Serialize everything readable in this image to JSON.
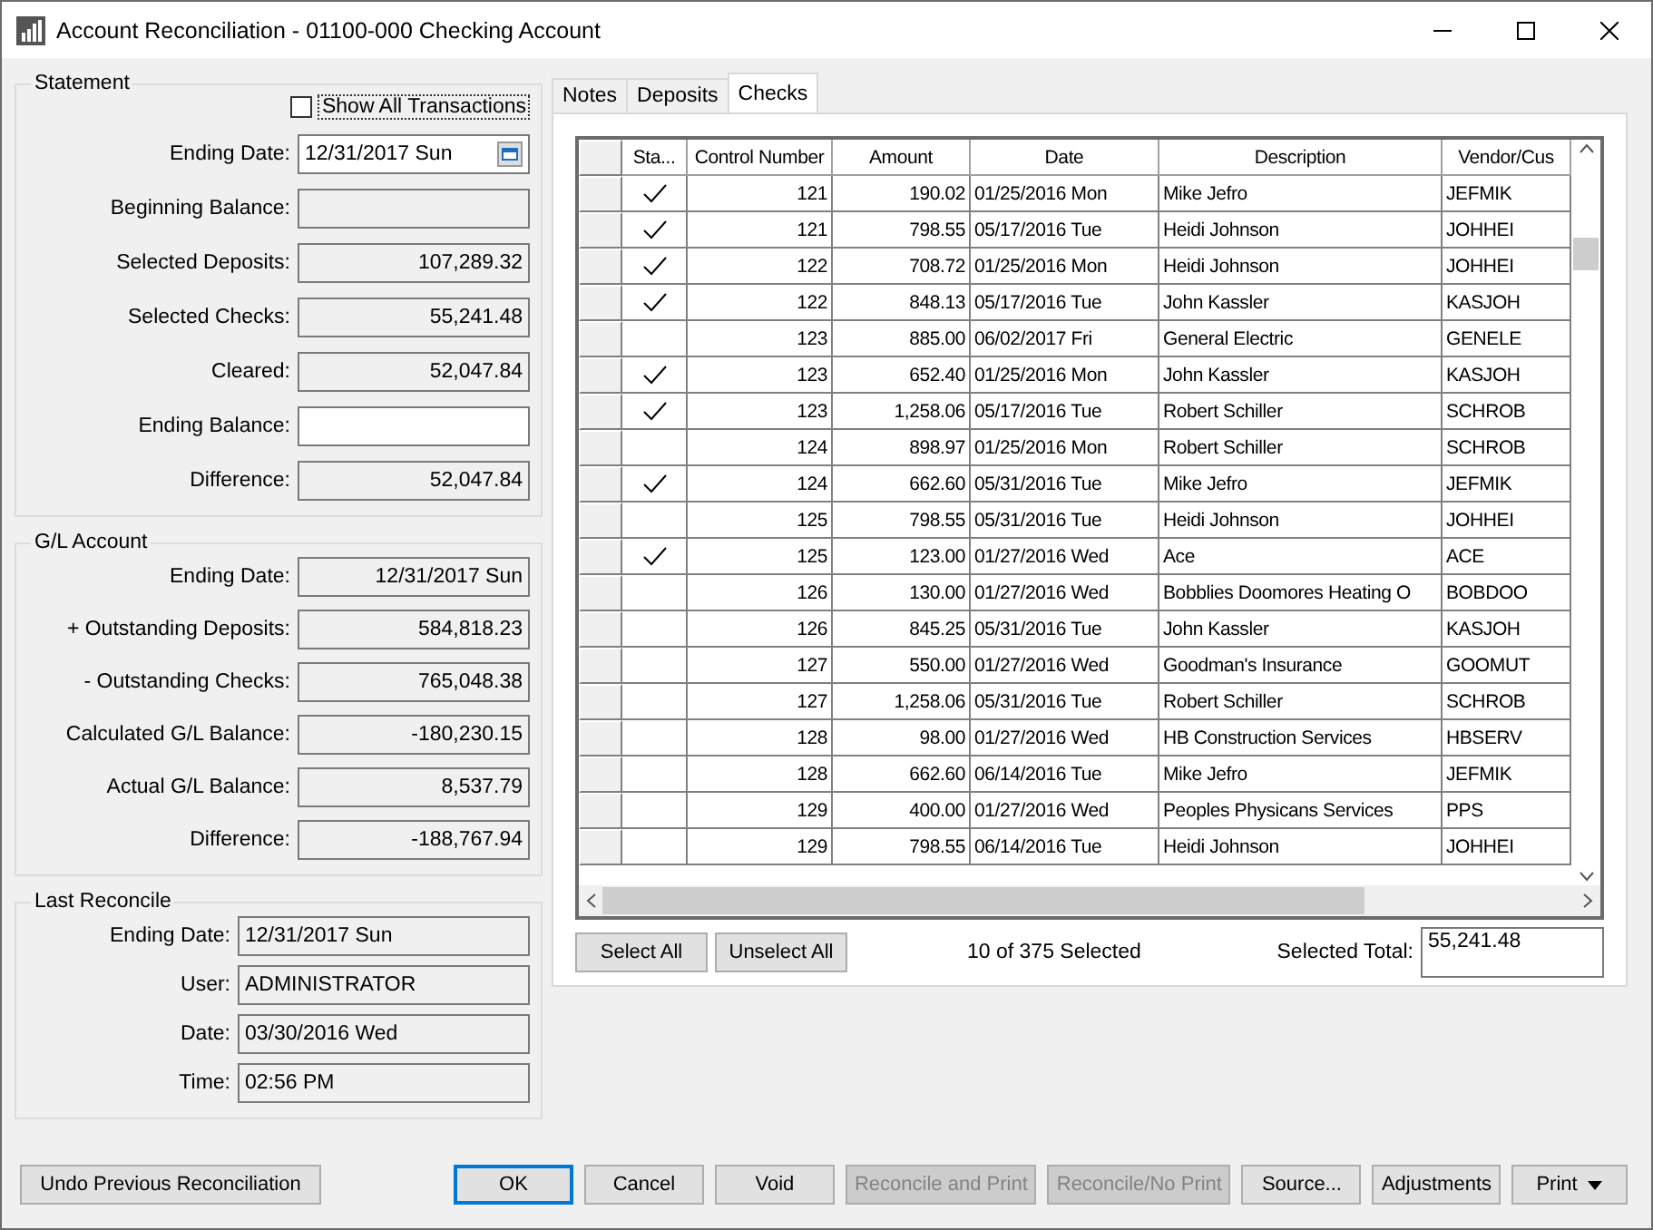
{
  "window": {
    "title": "Account Reconciliation - 01100-000 Checking Account"
  },
  "statement": {
    "title": "Statement",
    "show_all": {
      "label": "Show All Transactions",
      "checked": false
    },
    "fields": [
      {
        "label": "Ending Date:",
        "value": "12/31/2017 Sun",
        "kind": "date"
      },
      {
        "label": "Beginning Balance:",
        "kind": "readonly"
      },
      {
        "label": "Selected Deposits:",
        "value": "107,289.32",
        "kind": "readonly"
      },
      {
        "label": "Selected Checks:",
        "value": "55,241.48",
        "kind": "readonly"
      },
      {
        "label": "Cleared:",
        "value": "52,047.84",
        "kind": "readonly"
      },
      {
        "label": "Ending Balance:",
        "kind": "editable"
      },
      {
        "label": "Difference:",
        "value": "52,047.84",
        "kind": "readonly"
      }
    ]
  },
  "gl_account": {
    "title": "G/L Account",
    "fields": [
      {
        "label": "Ending Date:",
        "value": "12/31/2017 Sun"
      },
      {
        "label": "+ Outstanding Deposits:",
        "value": "584,818.23"
      },
      {
        "label": "- Outstanding Checks:",
        "value": "765,048.38"
      },
      {
        "label": "Calculated G/L Balance:",
        "value": "-180,230.15"
      },
      {
        "label": "Actual G/L Balance:",
        "value": "8,537.79"
      },
      {
        "label": "Difference:",
        "value": "-188,767.94"
      }
    ]
  },
  "last_reconcile": {
    "title": "Last Reconcile",
    "fields": [
      {
        "label": "Ending Date:",
        "value": "12/31/2017 Sun"
      },
      {
        "label": "User:",
        "value": "ADMINISTRATOR"
      },
      {
        "label": "Date:",
        "value": "03/30/2016 Wed"
      },
      {
        "label": "Time:",
        "value": "02:56 PM"
      }
    ]
  },
  "tabs": [
    {
      "label": "Notes",
      "selected": false
    },
    {
      "label": "Deposits",
      "selected": false
    },
    {
      "label": "Checks",
      "selected": true
    }
  ],
  "table": {
    "status_header": "Sta...",
    "columns": [
      "Control Number",
      "Amount",
      "Date",
      "Description",
      "Vendor/Cus"
    ],
    "rows": [
      {
        "checked": true,
        "cells": [
          "121",
          "190.02",
          "01/25/2016 Mon",
          "Mike Jefro",
          "JEFMIK"
        ]
      },
      {
        "checked": true,
        "cells": [
          "121",
          "798.55",
          "05/17/2016 Tue",
          "Heidi Johnson",
          "JOHHEI"
        ]
      },
      {
        "checked": true,
        "cells": [
          "122",
          "708.72",
          "01/25/2016 Mon",
          "Heidi Johnson",
          "JOHHEI"
        ]
      },
      {
        "checked": true,
        "cells": [
          "122",
          "848.13",
          "05/17/2016 Tue",
          "John Kassler",
          "KASJOH"
        ]
      },
      {
        "checked": false,
        "cells": [
          "123",
          "885.00",
          "06/02/2017 Fri",
          "General Electric",
          "GENELE"
        ]
      },
      {
        "checked": true,
        "cells": [
          "123",
          "652.40",
          "01/25/2016 Mon",
          "John Kassler",
          "KASJOH"
        ]
      },
      {
        "checked": true,
        "cells": [
          "123",
          "1,258.06",
          "05/17/2016 Tue",
          "Robert Schiller",
          "SCHROB"
        ]
      },
      {
        "checked": false,
        "cells": [
          "124",
          "898.97",
          "01/25/2016 Mon",
          "Robert Schiller",
          "SCHROB"
        ]
      },
      {
        "checked": true,
        "cells": [
          "124",
          "662.60",
          "05/31/2016 Tue",
          "Mike Jefro",
          "JEFMIK"
        ]
      },
      {
        "checked": false,
        "cells": [
          "125",
          "798.55",
          "05/31/2016 Tue",
          "Heidi Johnson",
          "JOHHEI"
        ]
      },
      {
        "checked": true,
        "cells": [
          "125",
          "123.00",
          "01/27/2016 Wed",
          "Ace",
          "ACE"
        ]
      },
      {
        "checked": false,
        "cells": [
          "126",
          "130.00",
          "01/27/2016 Wed",
          "Bobblies Doomores Heating O",
          "BOBDOO"
        ]
      },
      {
        "checked": false,
        "cells": [
          "126",
          "845.25",
          "05/31/2016 Tue",
          "John Kassler",
          "KASJOH"
        ]
      },
      {
        "checked": false,
        "cells": [
          "127",
          "550.00",
          "01/27/2016 Wed",
          "Goodman's Insurance",
          "GOOMUT"
        ]
      },
      {
        "checked": false,
        "cells": [
          "127",
          "1,258.06",
          "05/31/2016 Tue",
          "Robert Schiller",
          "SCHROB"
        ]
      },
      {
        "checked": false,
        "cells": [
          "128",
          "98.00",
          "01/27/2016 Wed",
          "HB Construction Services",
          "HBSERV"
        ]
      },
      {
        "checked": false,
        "cells": [
          "128",
          "662.60",
          "06/14/2016 Tue",
          "Mike Jefro",
          "JEFMIK"
        ]
      },
      {
        "checked": false,
        "cells": [
          "129",
          "400.00",
          "01/27/2016 Wed",
          "Peoples Physicans Services",
          "PPS"
        ]
      },
      {
        "checked": false,
        "cells": [
          "129",
          "798.55",
          "06/14/2016 Tue",
          "Heidi Johnson",
          "JOHHEI"
        ]
      }
    ]
  },
  "selection": {
    "select_all": "Select All",
    "unselect_all": "Unselect All",
    "count": "10 of 375 Selected",
    "total_label": "Selected Total:",
    "total": "55,241.48"
  },
  "undo_button": {
    "label": "Undo Previous Reconciliation"
  },
  "buttons": [
    {
      "label": "OK",
      "kind": "default",
      "disabled": false
    },
    {
      "label": "Cancel",
      "kind": "plain",
      "disabled": false
    },
    {
      "label": "Void",
      "kind": "plain",
      "disabled": false
    },
    {
      "label": "Reconcile and Print",
      "kind": "plain",
      "disabled": true
    },
    {
      "label": "Reconcile/No Print",
      "kind": "plain",
      "disabled": true
    },
    {
      "label": "Source...",
      "kind": "plain",
      "disabled": false
    },
    {
      "label": "Adjustments",
      "kind": "plain",
      "disabled": false
    },
    {
      "label": "Print",
      "kind": "menu",
      "disabled": false
    }
  ]
}
